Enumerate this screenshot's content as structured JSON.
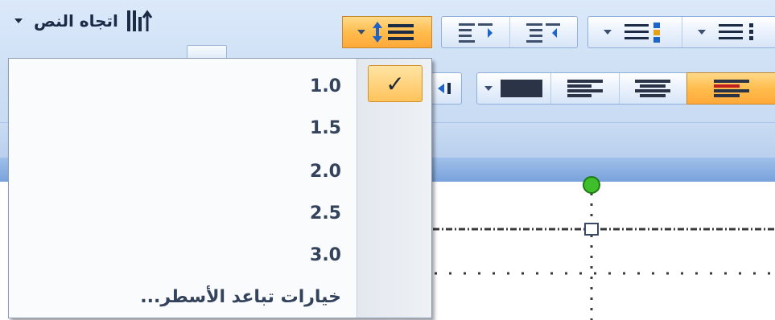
{
  "ribbon": {
    "text_direction_label": "اتجاه النص",
    "icons": {
      "text_direction": "text-direction-icon",
      "line_spacing": "line-spacing-icon",
      "decrease_indent": "decrease-indent-icon",
      "increase_indent": "increase-indent-icon",
      "numbering": "numbering-icon",
      "bullets": "bullets-icon",
      "align_right": "align-right-icon",
      "align_center": "align-center-icon",
      "align_justify": "align-justify-icon",
      "align_left": "align-left-icon"
    },
    "active_color": "#ffbd4d"
  },
  "line_spacing_menu": {
    "options": [
      "1.0",
      "1.5",
      "2.0",
      "2.5",
      "3.0"
    ],
    "selected": "1.0",
    "check_mark": "✓",
    "more_options_label": "خيارات تباعد الأسطر..."
  },
  "colors": {
    "ribbon_bg": "#cfe0f5",
    "menu_bg": "#fafbfd",
    "highlight": "#ffc35b",
    "handle_green": "#3fbf2b"
  }
}
